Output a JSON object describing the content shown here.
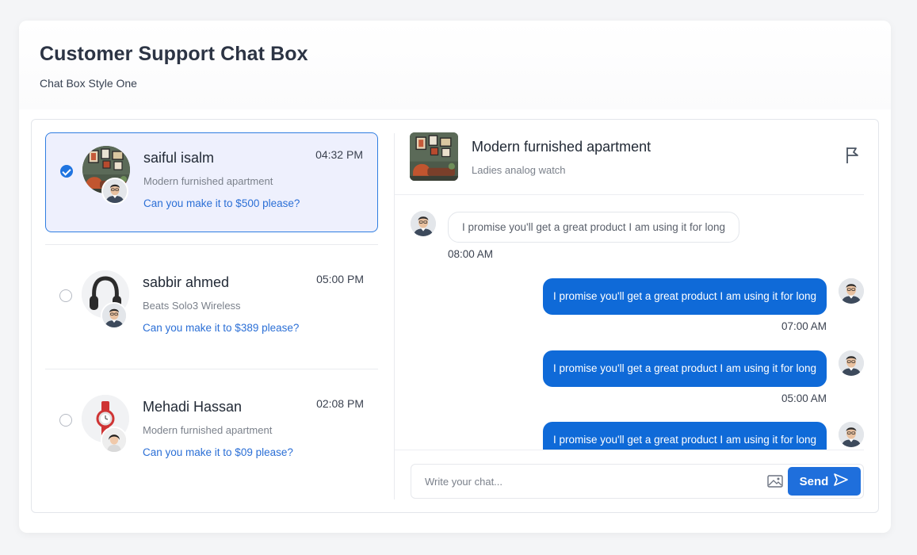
{
  "page": {
    "title": "Customer Support Chat Box",
    "subtitle": "Chat Box Style One"
  },
  "conversations": [
    {
      "name": "saiful isalm",
      "time": "04:32 PM",
      "product": "Modern furnished apartment",
      "last_message": "Can you make it to $500 please?",
      "selected": true,
      "thumb_icon": "apartment-photo"
    },
    {
      "name": "sabbir ahmed",
      "time": "05:00 PM",
      "product": "Beats Solo3 Wireless",
      "last_message": "Can you make it to $389 please?",
      "selected": false,
      "thumb_icon": "headphones-photo"
    },
    {
      "name": "Mehadi Hassan",
      "time": "02:08 PM",
      "product": "Modern furnished apartment",
      "last_message": "Can you make it to $09 please?",
      "selected": false,
      "thumb_icon": "watch-photo"
    }
  ],
  "chat": {
    "title": "Modern furnished apartment",
    "subtitle": "Ladies analog watch",
    "messages": [
      {
        "direction": "in",
        "text": "I promise you'll get a great product I am using it for long",
        "time": "08:00 AM"
      },
      {
        "direction": "out",
        "text": "I promise you'll get a great product I am using it for long",
        "time": "07:00 AM"
      },
      {
        "direction": "out",
        "text": "I promise you'll get a great product I am using it for long",
        "time": "05:00 AM"
      },
      {
        "direction": "out",
        "text": "I promise you'll get a great product I am using it for long",
        "time": ""
      }
    ]
  },
  "composer": {
    "placeholder": "Write your chat...",
    "send_label": "Send"
  },
  "colors": {
    "accent": "#1f6fdc",
    "link": "#2b6fd6",
    "active_bg": "#eef0fd",
    "active_border": "#2f7de1"
  }
}
